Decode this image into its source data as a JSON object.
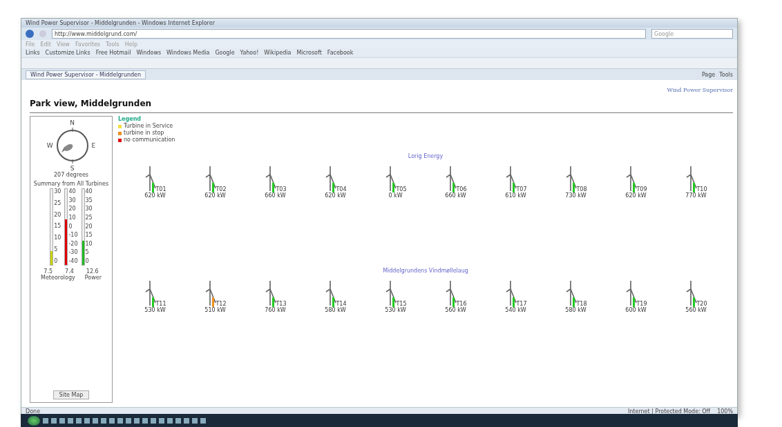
{
  "window": {
    "title": "Wind Power Supervisor - Middelgrunden - Windows Internet Explorer"
  },
  "address_bar": {
    "url": "http://www.middelgrund.com/",
    "search_placeholder": "Google"
  },
  "menu_bar": [
    "File",
    "Edit",
    "View",
    "Favorites",
    "Tools",
    "Help"
  ],
  "links_bar": [
    "Links",
    "Customize Links",
    "Free Hotmail",
    "Windows",
    "Windows Media",
    "Google",
    "Yahoo!",
    "Wikipedia",
    "Microsoft",
    "Facebook"
  ],
  "tab": {
    "label": "Wind Power Supervisor - Middelgrunden"
  },
  "command_bar": [
    "Page",
    "Tools"
  ],
  "page": {
    "brand": "Wind Power Supervisor",
    "heading": "Park view, Middelgrunden",
    "wind": {
      "compass": [
        "N",
        "E",
        "S",
        "W"
      ],
      "direction": "207 degrees"
    },
    "summary": {
      "title": "Summary from All Turbines",
      "gauges": [
        {
          "ticks": [
            "30",
            "25",
            "20",
            "15",
            "10",
            "5",
            "0"
          ],
          "level": 0.18,
          "color": "#c8d400",
          "reading": "7.5"
        },
        {
          "ticks": [
            "40",
            "30",
            "20",
            "10",
            "0",
            "-10",
            "-20",
            "-30",
            "-40"
          ],
          "level": 0.6,
          "color": "#e00000",
          "reading": "7.4"
        },
        {
          "ticks": [
            "40",
            "35",
            "30",
            "25",
            "20",
            "15",
            "10",
            "5",
            "0"
          ],
          "level": 0.32,
          "color": "#22bb22",
          "reading": "12.6"
        }
      ],
      "labels": [
        "Meteorology",
        "Power"
      ]
    },
    "site_map": "Site Map",
    "legend": {
      "title": "Legend",
      "items": [
        {
          "label": "Turbine in Service",
          "color": "#f0e040"
        },
        {
          "label": "turbine in stop",
          "color": "#f09020"
        },
        {
          "label": "no communication",
          "color": "#e01010"
        }
      ]
    },
    "parks": [
      {
        "name": "Lorig Energy",
        "turbines": [
          {
            "id": "T01",
            "power": "620 kW",
            "color": "#22cc22"
          },
          {
            "id": "T02",
            "power": "620 kW",
            "color": "#22cc22"
          },
          {
            "id": "T03",
            "power": "660 kW",
            "color": "#22cc22"
          },
          {
            "id": "T04",
            "power": "620 kW",
            "color": "#22cc22"
          },
          {
            "id": "T05",
            "power": "0 kW",
            "color": "#22cc22"
          },
          {
            "id": "T06",
            "power": "660 kW",
            "color": "#22cc22"
          },
          {
            "id": "T07",
            "power": "610 kW",
            "color": "#22cc22"
          },
          {
            "id": "T08",
            "power": "730 kW",
            "color": "#22cc22"
          },
          {
            "id": "T09",
            "power": "620 kW",
            "color": "#22cc22"
          },
          {
            "id": "T10",
            "power": "770 kW",
            "color": "#22cc22"
          }
        ]
      },
      {
        "name": "Middelgrundens Vindmøllelaug",
        "turbines": [
          {
            "id": "T11",
            "power": "530 kW",
            "color": "#22cc22"
          },
          {
            "id": "T12",
            "power": "510 kW",
            "color": "#f09020"
          },
          {
            "id": "T13",
            "power": "760 kW",
            "color": "#22cc22"
          },
          {
            "id": "T14",
            "power": "580 kW",
            "color": "#22cc22"
          },
          {
            "id": "T15",
            "power": "530 kW",
            "color": "#22cc22"
          },
          {
            "id": "T16",
            "power": "560 kW",
            "color": "#22cc22"
          },
          {
            "id": "T17",
            "power": "540 kW",
            "color": "#22cc22"
          },
          {
            "id": "T18",
            "power": "580 kW",
            "color": "#22cc22"
          },
          {
            "id": "T19",
            "power": "600 kW",
            "color": "#22cc22"
          },
          {
            "id": "T20",
            "power": "560 kW",
            "color": "#22cc22"
          }
        ]
      }
    ]
  },
  "status_bar": {
    "text": "Done",
    "zone": "Internet | Protected Mode: Off",
    "zoom": "100%"
  }
}
